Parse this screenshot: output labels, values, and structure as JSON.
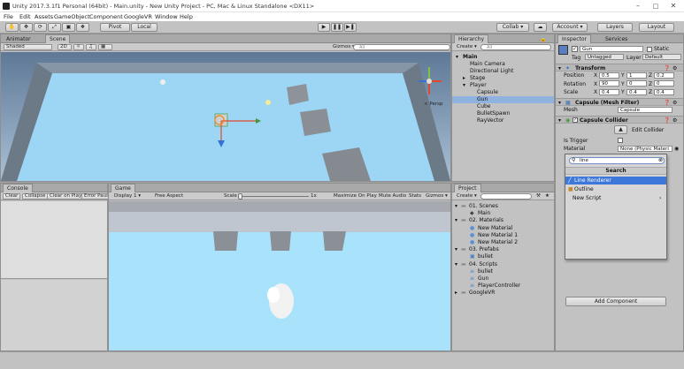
{
  "window": {
    "title": "Unity 2017.3.1f1 Personal (64bit) - Main.unity - New Unity Project - PC, Mac & Linux Standalone <DX11>"
  },
  "menu": [
    "File",
    "Edit",
    "Assets",
    "GameObject",
    "Component",
    "GoogleVR",
    "Window",
    "Help"
  ],
  "toolbar": {
    "pivot": "Pivot",
    "local": "Local",
    "collab": "Collab ▾",
    "account": "Account ▾",
    "layers": "Layers",
    "layout": "Layout"
  },
  "scene_panel": {
    "tabs": [
      "Animator",
      "Scene"
    ],
    "shading": "Shaded",
    "mode_2d": "2D",
    "gizmos": "Gizmos ▾",
    "search": "All",
    "persp": "< Persp"
  },
  "console_panel": {
    "tab": "Console",
    "buttons": [
      "Clear",
      "Collapse",
      "Clear on Play",
      "Error Paus"
    ]
  },
  "game_panel": {
    "tab": "Game",
    "display": "Display 1",
    "aspect": "Free Aspect",
    "scale_label": "Scale",
    "scale_value": "1x",
    "buttons": [
      "Maximize On Play",
      "Mute Audio",
      "Stats",
      "Gizmos ▾"
    ]
  },
  "hierarchy": {
    "tab": "Hierarchy",
    "create": "Create ▾",
    "search": "All",
    "items": [
      {
        "label": "Main",
        "depth": 0,
        "bold": true,
        "arrow": "▾"
      },
      {
        "label": "Main Camera",
        "depth": 1
      },
      {
        "label": "Directional Light",
        "depth": 1
      },
      {
        "label": "Stage",
        "depth": 1,
        "arrow": "▸"
      },
      {
        "label": "Player",
        "depth": 1,
        "arrow": "▾"
      },
      {
        "label": "Capsule",
        "depth": 2
      },
      {
        "label": "Gun",
        "depth": 2,
        "selected": true
      },
      {
        "label": "Cube",
        "depth": 2
      },
      {
        "label": "BulletSpawn",
        "depth": 2
      },
      {
        "label": "RayVector",
        "depth": 2
      }
    ]
  },
  "project": {
    "tab": "Project",
    "create": "Create ▾",
    "items": [
      {
        "label": "01. Scenes",
        "depth": 0,
        "type": "folder",
        "arrow": "▾"
      },
      {
        "label": "Main",
        "depth": 1,
        "type": "scene"
      },
      {
        "label": "02. Materials",
        "depth": 0,
        "type": "folder",
        "arrow": "▾"
      },
      {
        "label": "New Material",
        "depth": 1,
        "type": "material"
      },
      {
        "label": "New Material 1",
        "depth": 1,
        "type": "material"
      },
      {
        "label": "New Material 2",
        "depth": 1,
        "type": "material"
      },
      {
        "label": "03. Prefabs",
        "depth": 0,
        "type": "folder",
        "arrow": "▾"
      },
      {
        "label": "bullet",
        "depth": 1,
        "type": "prefab"
      },
      {
        "label": "04. Scripts",
        "depth": 0,
        "type": "folder",
        "arrow": "▾"
      },
      {
        "label": "bullet",
        "depth": 1,
        "type": "script"
      },
      {
        "label": "Gun",
        "depth": 1,
        "type": "script"
      },
      {
        "label": "PlayerController",
        "depth": 1,
        "type": "script"
      },
      {
        "label": "GoogleVR",
        "depth": 0,
        "type": "folder",
        "arrow": "▸"
      }
    ]
  },
  "inspector": {
    "tabs": [
      "Inspector",
      "Services"
    ],
    "object_name": "Gun",
    "static_label": "Static",
    "tag_label": "Tag",
    "tag_value": "Untagged",
    "layer_label": "Layer",
    "layer_value": "Default",
    "transform": {
      "title": "Transform",
      "rows": [
        {
          "label": "Position",
          "x": "0.5",
          "y": "1",
          "z": "0.2"
        },
        {
          "label": "Rotation",
          "x": "90",
          "y": "0",
          "z": "0"
        },
        {
          "label": "Scale",
          "x": "0.4",
          "y": "0.4",
          "z": "0.4"
        }
      ],
      "axis_x": "X",
      "axis_y": "Y",
      "axis_z": "Z"
    },
    "mesh_filter": {
      "title": "Capsule (Mesh Filter)",
      "mesh_label": "Mesh",
      "mesh_value": "Capsule"
    },
    "collider": {
      "title": "Capsule Collider",
      "edit_label": "Edit Collider",
      "trigger_label": "Is Trigger",
      "material_label": "Material",
      "material_value": "None (Physic Materi"
    },
    "add_component": "Add Component"
  },
  "component_popup": {
    "search_value": "line",
    "header": "Search",
    "items": [
      {
        "label": "Line Renderer",
        "selected": true
      },
      {
        "label": "Outline"
      },
      {
        "label": "New Script",
        "arrow": "›"
      }
    ]
  },
  "colors": {
    "selection": "#3d77d9",
    "floor": "#9dd6f5",
    "sky": "#8aa9c7",
    "collider_green": "#3c9b3c"
  }
}
